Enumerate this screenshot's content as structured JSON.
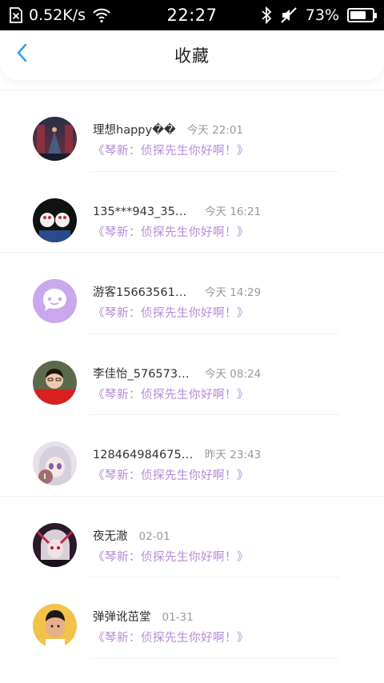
{
  "status_bar": {
    "speed": "0.52K/s",
    "time": "22:27",
    "battery": "73%",
    "battery_level": 0.73
  },
  "header": {
    "title": "收藏"
  },
  "colors": {
    "accent_blue": "#3a9fe6",
    "preview_purple": "#b48ad8"
  },
  "favorites": [
    {
      "name": "理想happy��",
      "time": "今天 22:01",
      "preview": "《琴新：侦探先生你好啊！》"
    },
    {
      "name": "135***943_35760...",
      "time": "今天 16:21",
      "preview": "《琴新：侦探先生你好啊！》"
    },
    {
      "name": "游客1566356175...",
      "time": "今天 14:29",
      "preview": "《琴新：侦探先生你好啊！》"
    },
    {
      "name": "李佳怡_5765738...",
      "time": "今天 08:24",
      "preview": "《琴新：侦探先生你好啊！》"
    },
    {
      "name": "128464984675bi...",
      "time": "昨天 23:43",
      "preview": "《琴新：侦探先生你好啊！》"
    },
    {
      "name": "夜无澈",
      "time": "02-01",
      "preview": "《琴新：侦探先生你好啊！》"
    },
    {
      "name": "弹弹讹茁堂",
      "time": "01-31",
      "preview": "《琴新：侦探先生你好啊！》"
    }
  ]
}
